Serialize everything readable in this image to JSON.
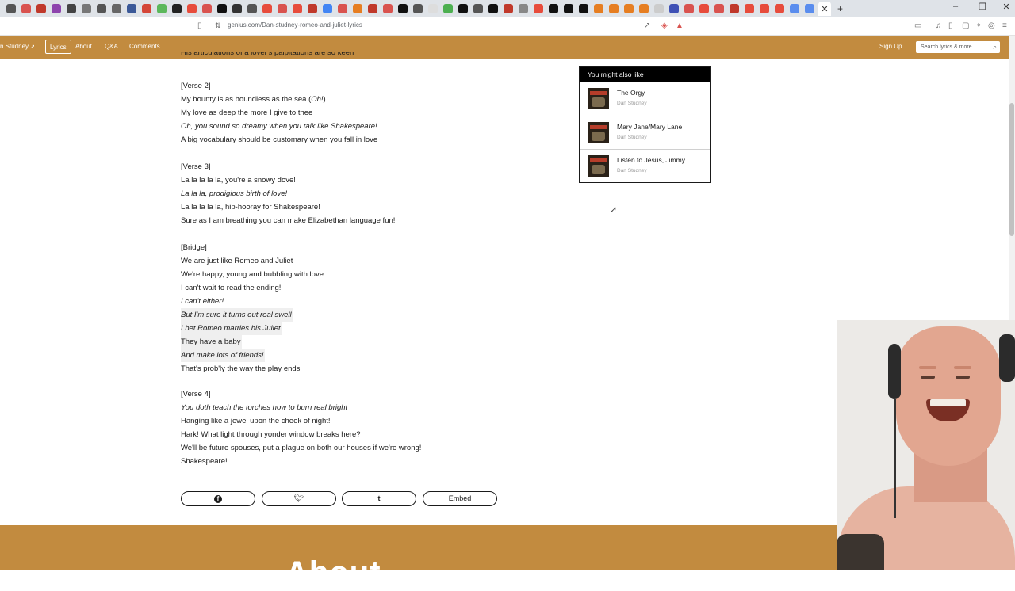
{
  "browser": {
    "url": "genius.com/Dan-studney-romeo-and-juliet-lyrics",
    "tab_colors": [
      "#555555",
      "#d9534f",
      "#c0392b",
      "#8e44ad",
      "#444444",
      "#777777",
      "#555555",
      "#666666",
      "#3b5998",
      "#d44638",
      "#5cb85c",
      "#222222",
      "#e74c3c",
      "#d9534f",
      "#111111",
      "#333333",
      "#555555",
      "#e74c3c",
      "#d9534f",
      "#e74c3c",
      "#c0392b",
      "#4285f4",
      "#d9534f",
      "#e67e22",
      "#c0392b",
      "#d9534f",
      "#111111",
      "#555555",
      "#dddddd",
      "#4caf50",
      "#111111",
      "#555555",
      "#111111",
      "#c0392b",
      "#888888",
      "#e74c3c",
      "#111111",
      "#111111",
      "#111111",
      "#e67e22",
      "#e67e22",
      "#e67e22",
      "#e67e22",
      "#cccccc",
      "#3f51b5",
      "#d9534f",
      "#e74c3c",
      "#d9534f",
      "#c0392b",
      "#e74c3c",
      "#e74c3c",
      "#e74c3c",
      "#5a8dee",
      "#5a8dee"
    ],
    "active_tab_icon": "close-icon",
    "new_tab": "+",
    "window_controls": [
      "–",
      "❐",
      "✕"
    ]
  },
  "nav": {
    "artist_crumb": "n Studney",
    "artist_crumb_icon": "arrow-up-right-icon",
    "items": {
      "lyrics": "Lyrics",
      "about": "About",
      "qa": "Q&A",
      "comments": "Comments"
    },
    "sign_up": "Sign Up",
    "search_placeholder": "Search lyrics & more",
    "search_icon": "search-icon"
  },
  "lyrics": {
    "clipped_line": "His articulations of a lover's palpitations are so keen",
    "verse2": {
      "header": "[Verse 2]",
      "l1_a": "My bounty is as boundless as the sea (",
      "l1_b": "Oh!",
      "l1_c": ")",
      "l2": "My love as deep the more I give to thee",
      "l3": "Oh, you sound so dreamy when you talk like Shakespeare!",
      "l4": "A big vocabulary should be customary when you fall in love"
    },
    "verse3": {
      "header": "[Verse 3]",
      "l1": "La la la la la, you're a snowy dove!",
      "l2": "La la la, prodigious birth of love!",
      "l3": "La la la la la, hip-hooray for Shakespeare!",
      "l4": "Sure as I am breathing you can make Elizabethan language fun!"
    },
    "bridge": {
      "header": "[Bridge]",
      "l1": "We are just like Romeo and Juliet",
      "l2": "We're happy, young and bubbling with love",
      "l3": "I can't wait to read the ending!",
      "l4": "I can't either!",
      "l5": "But I'm sure it turns out real swell",
      "l6": "I bet Romeo marries his Juliet",
      "l7": "They have a baby",
      "l8": "And make lots of friends!",
      "l9": "That's prob'ly the way the play ends"
    },
    "verse4": {
      "header": "[Verse 4]",
      "l1": "You doth teach the torches how to burn real bright",
      "l2": "Hanging like a jewel upon the cheek of night!",
      "l3": "Hark! What light through yonder window breaks here?",
      "l4": "We'll be future spouses, put a plague on both our houses if we're wrong!",
      "l5": "Shakespeare!"
    }
  },
  "share": {
    "facebook_icon": "facebook-icon",
    "twitter_icon": "twitter-icon",
    "tumblr_icon": "tumblr-icon",
    "embed": "Embed"
  },
  "ymal": {
    "title": "You might also like",
    "songs": [
      {
        "title": "The Orgy",
        "artist": "Dan Studney"
      },
      {
        "title": "Mary Jane/Mary Lane",
        "artist": "Dan Studney"
      },
      {
        "title": "Listen to Jesus, Jimmy",
        "artist": "Dan Studney"
      }
    ]
  },
  "about": {
    "title": "About"
  },
  "colors": {
    "brand": "#c28b3f",
    "text": "#1a1a1a",
    "annotation_bg": "#efefef"
  }
}
